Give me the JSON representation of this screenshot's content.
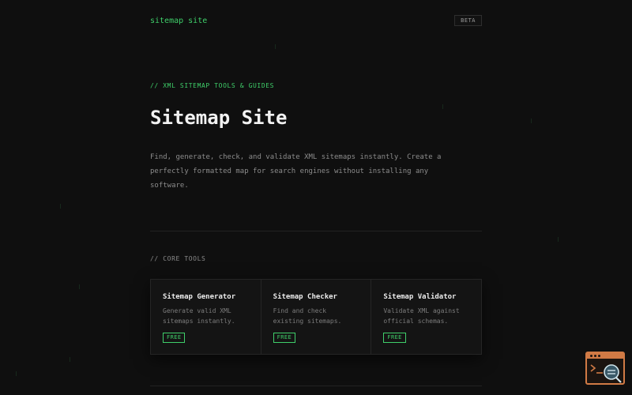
{
  "header": {
    "brand": "sitemap site",
    "badge": "BETA"
  },
  "hero": {
    "eyebrow": "// XML SITEMAP TOOLS & GUIDES",
    "title": "Sitemap Site",
    "description": "Find, generate, check, and validate XML sitemaps instantly. Create a perfectly formatted map for search engines without installing any software."
  },
  "core_tools": {
    "label": "// CORE TOOLS",
    "cards": [
      {
        "title": "Sitemap Generator",
        "description": "Generate valid XML sitemaps instantly.",
        "badge": "FREE"
      },
      {
        "title": "Sitemap Checker",
        "description": "Find and check existing sitemaps.",
        "badge": "FREE"
      },
      {
        "title": "Sitemap Validator",
        "description": "Validate XML against official schemas.",
        "badge": "FREE"
      }
    ]
  },
  "colors": {
    "accent": "#3fcf6a",
    "background": "#0f0f0f",
    "helper": "#d07a45"
  },
  "icons": {
    "helper": "terminal-search-icon"
  }
}
